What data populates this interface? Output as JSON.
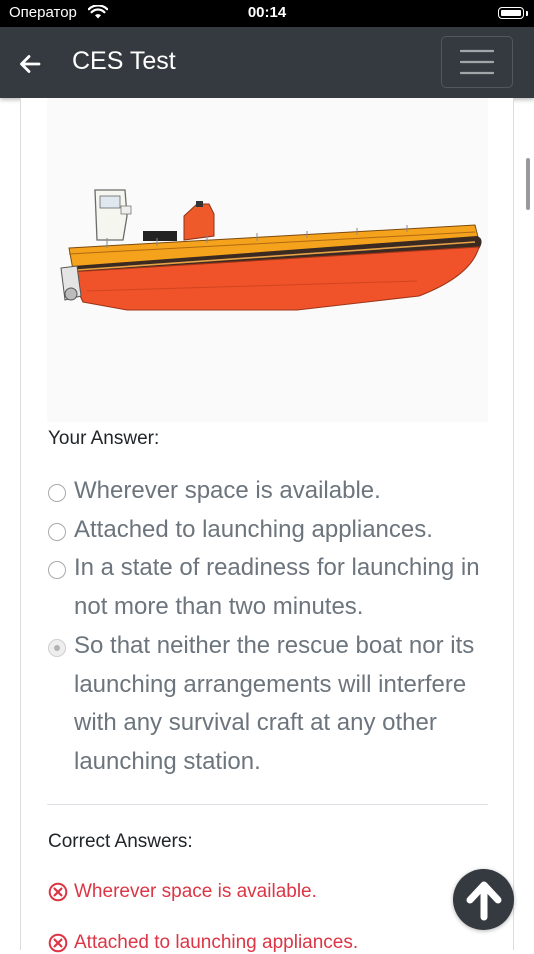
{
  "status_bar": {
    "carrier": "Оператор",
    "time": "00:14"
  },
  "navbar": {
    "title": "CES Test"
  },
  "question": {
    "your_answer_label": "Your Answer:",
    "options": [
      {
        "text": "Wherever space is available.",
        "selected": false
      },
      {
        "text": "Attached to launching appliances.",
        "selected": false
      },
      {
        "text": "In a state of readiness for launching in not more than two minutes.",
        "selected": false
      },
      {
        "text": "So that neither the rescue boat nor its launching arrangements will interfere with any survival craft at any other launching station.",
        "selected": true
      }
    ],
    "correct_answers_label": "Correct Answers:",
    "wrong_answers": [
      "Wherever space is available.",
      "Attached to launching appliances."
    ]
  },
  "colors": {
    "navbar": "#343a40",
    "error": "#dc3545",
    "muted_text": "#6c757d",
    "boat_hull": "#f0532a",
    "boat_deck": "#f5a21c"
  },
  "icons": {
    "back": "arrow-left-icon",
    "menu": "hamburger-icon",
    "wrong": "circle-x-icon",
    "scroll_top": "arrow-up-icon"
  }
}
